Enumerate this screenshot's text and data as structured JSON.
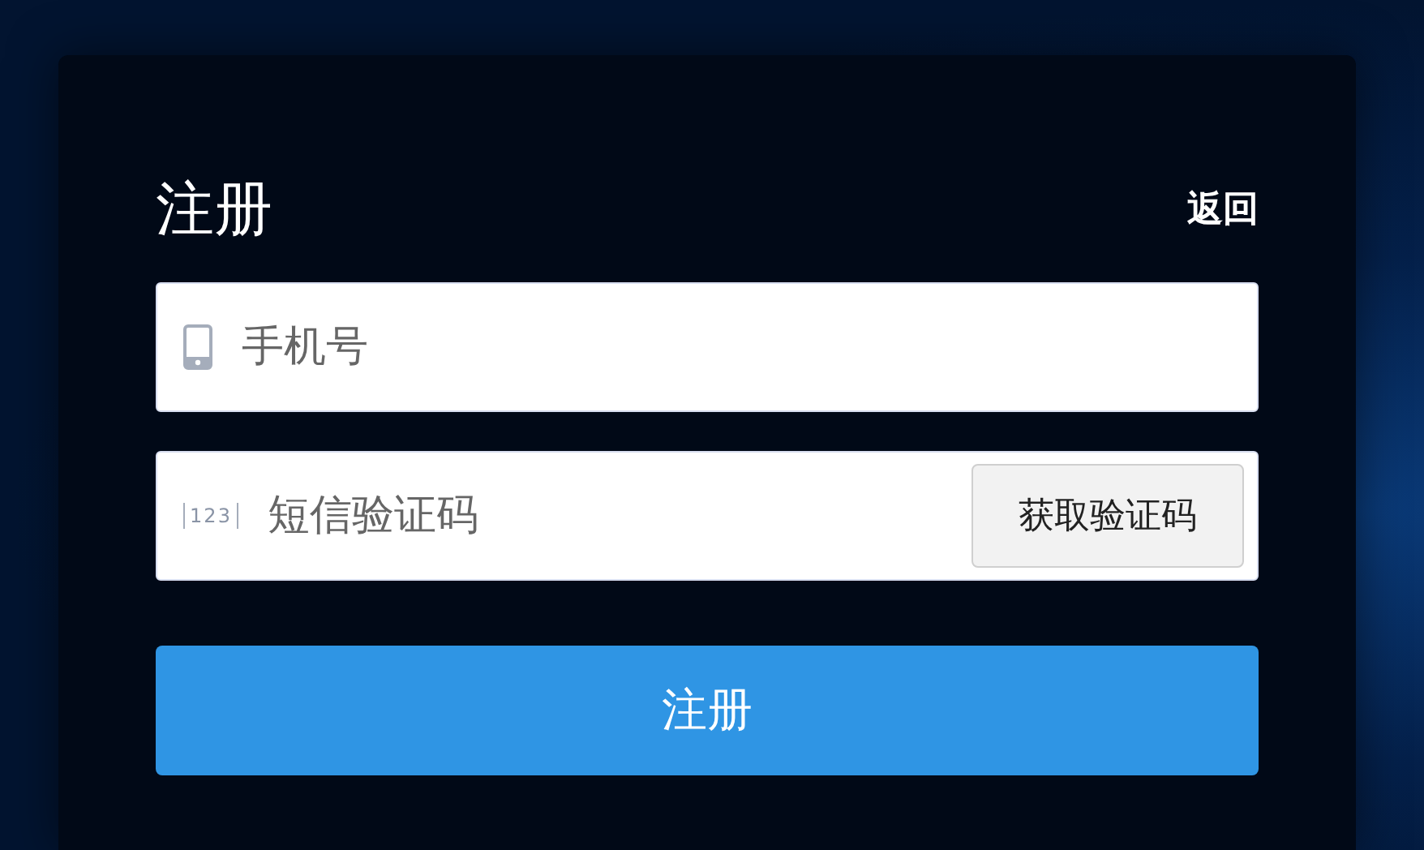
{
  "title": "注册",
  "back_link": "返回",
  "fields": [
    {
      "kind": "phone",
      "placeholder": "手机号"
    },
    {
      "kind": "code",
      "placeholder": "短信验证码",
      "icon_text": "123",
      "action": "获取验证码"
    }
  ],
  "submit": "注册"
}
